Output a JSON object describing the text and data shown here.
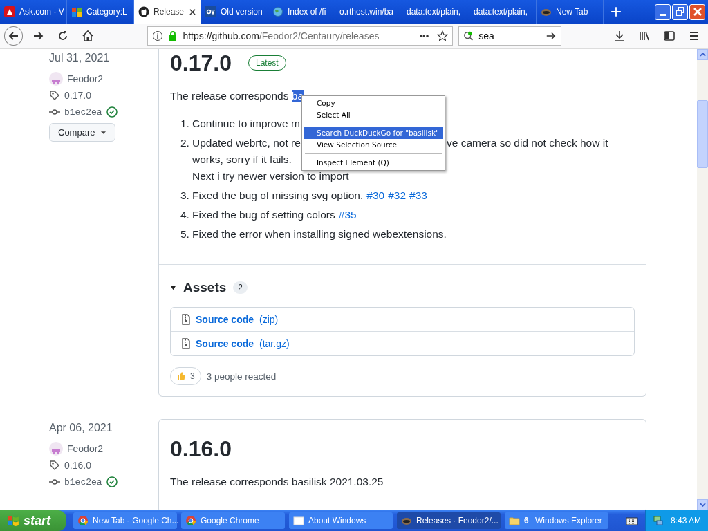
{
  "tabs": [
    {
      "label": "Ask.com - V",
      "kind": "ask",
      "selected": false
    },
    {
      "label": "Category:L",
      "kind": "windows",
      "selected": false
    },
    {
      "label": "Release",
      "kind": "github",
      "selected": true
    },
    {
      "label": "Old version",
      "kind": "ov",
      "selected": false
    },
    {
      "label": "Index of /fi",
      "kind": "globe",
      "selected": false
    },
    {
      "label": "o.rthost.win/ba",
      "kind": "none",
      "selected": false
    },
    {
      "label": "data:text/plain,",
      "kind": "none",
      "selected": false
    },
    {
      "label": "data:text/plain,",
      "kind": "none",
      "selected": false
    },
    {
      "label": "New Tab",
      "kind": "raccoon",
      "selected": false
    }
  ],
  "toolbar": {
    "url_host": "https://github.com",
    "url_path": "/Feodor2/Centaury/releases",
    "more": "•••",
    "search_value": "sea"
  },
  "releases": [
    {
      "date": "Jul 31, 2021",
      "author": "Feodor2",
      "tag": "0.17.0",
      "commit": "b1ec2ea",
      "verified": true,
      "compare": "Compare",
      "title": "0.17.0",
      "badge": "Latest",
      "intro": "The release corresponds ",
      "selection": "ba",
      "items": [
        {
          "number": "1.",
          "lines": [
            {
              "text": "Continue to improve m"
            }
          ]
        },
        {
          "number": "2.",
          "lines": [
            {
              "text": "Updated webrtc, not re",
              "resume": "ve camera so did not check how it"
            },
            {
              "text": "works, sorry if it fails."
            },
            {
              "text": "Next i try newer version to import"
            }
          ]
        },
        {
          "number": "3.",
          "lines": [
            {
              "text": "Fixed the bug of missing svg option.",
              "links": [
                "#30",
                "#32",
                "#33"
              ]
            }
          ]
        },
        {
          "number": "4.",
          "lines": [
            {
              "text": "Fixed the bug of setting colors",
              "links": [
                "#35"
              ]
            }
          ]
        },
        {
          "number": "5.",
          "lines": [
            {
              "text": "Fixed the error when installing signed webextensions."
            }
          ]
        }
      ],
      "assets": {
        "title": "Assets",
        "count": "2",
        "expanded": true,
        "files": [
          {
            "name": "Source code",
            "format": "(zip)"
          },
          {
            "name": "Source code",
            "format": "(tar.gz)"
          }
        ]
      },
      "reaction": {
        "count": "3",
        "text": "3 people reacted"
      }
    },
    {
      "date": "Apr 06, 2021",
      "author": "Feodor2",
      "tag": "0.16.0",
      "commit": "b1ec2ea",
      "verified": true,
      "title": "0.16.0",
      "intro": "The release corresponds basilisk 2021.03.25"
    }
  ],
  "context_menu": {
    "items": [
      {
        "label": "Copy",
        "kind": "item",
        "selected": false
      },
      {
        "label": "Select All",
        "kind": "item",
        "selected": false
      },
      {
        "kind": "separator"
      },
      {
        "label": "Search DuckDuckGo for \"basilisk\"",
        "kind": "item",
        "selected": true
      },
      {
        "label": "View Selection Source",
        "kind": "item",
        "selected": false
      },
      {
        "kind": "separator"
      },
      {
        "label": "Inspect Element (Q)",
        "kind": "item",
        "selected": false
      }
    ]
  },
  "taskbar": {
    "start": "start",
    "tasks": [
      {
        "label": "New Tab - Google Ch...",
        "kind": "chrome",
        "selected": false
      },
      {
        "label": "Google Chrome",
        "kind": "chrome",
        "selected": false
      },
      {
        "label": "About Windows",
        "kind": "window",
        "selected": false
      },
      {
        "label": "Releases · Feodor2/...",
        "kind": "raccoon",
        "selected": true
      }
    ],
    "group": {
      "count": "6",
      "label": "Windows Explorer"
    },
    "time": "8:43 AM"
  }
}
